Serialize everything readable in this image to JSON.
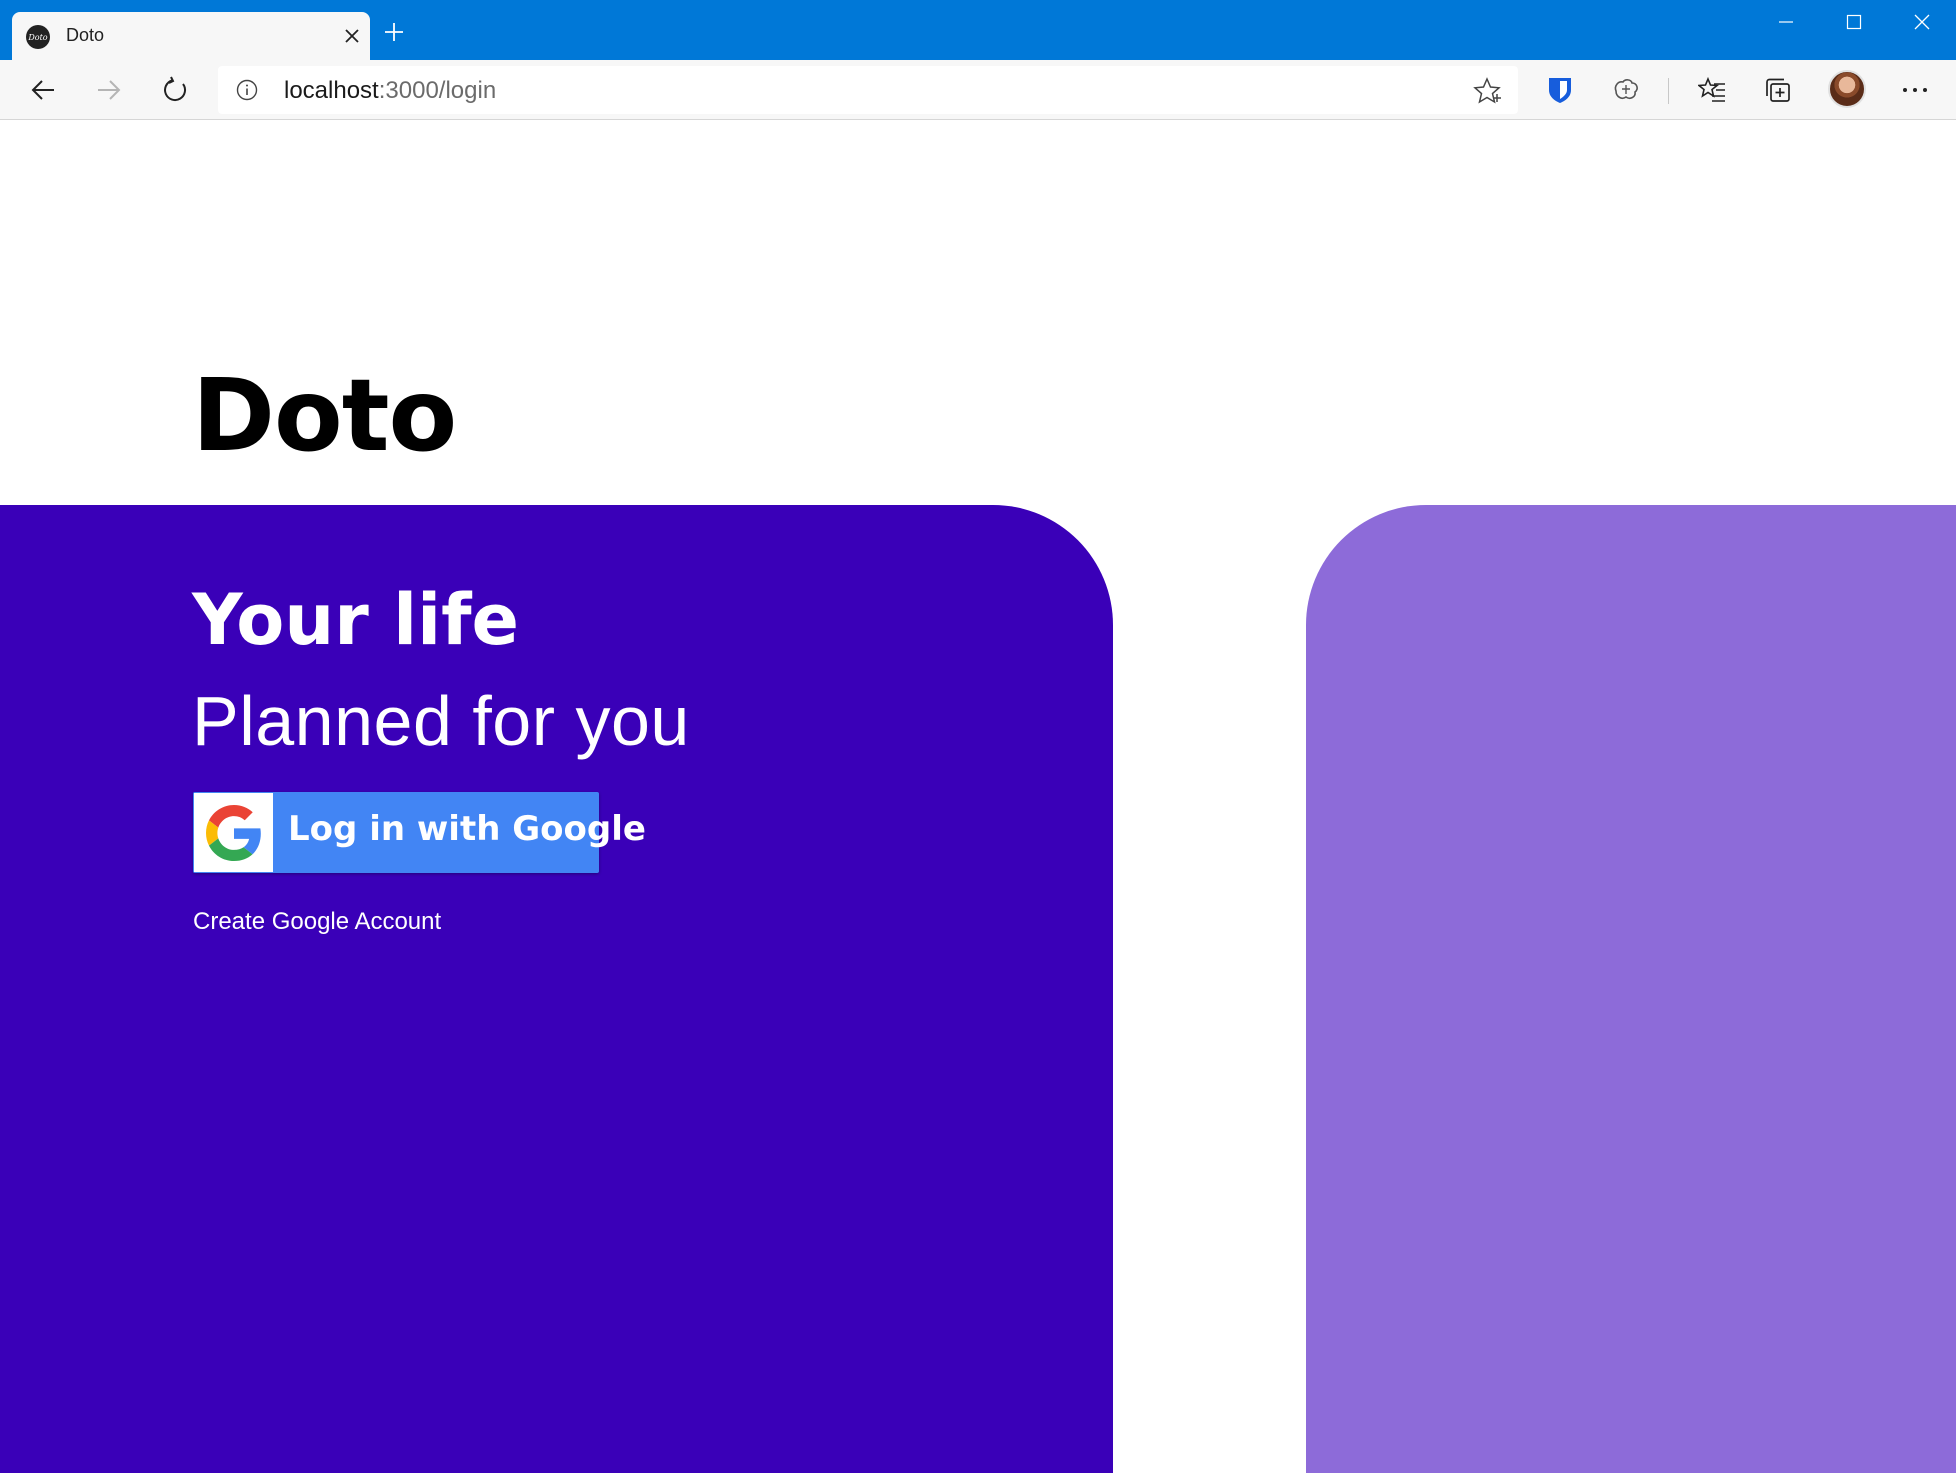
{
  "browser": {
    "tab": {
      "title": "Doto",
      "favicon_text": "Doto"
    },
    "new_tab_icon": "plus-icon",
    "window_controls": [
      "minimize-icon",
      "maximize-icon",
      "close-icon"
    ],
    "address": {
      "host": "localhost",
      "path": ":3000/login"
    },
    "toolbar_icons": [
      "back-arrow-icon",
      "forward-arrow-icon",
      "refresh-icon",
      "info-icon",
      "star-icon",
      "bitwarden-icon",
      "extension-icon",
      "favorites-icon",
      "collections-icon",
      "profile-avatar",
      "more-icon"
    ],
    "accent_color": "#0078d7"
  },
  "page": {
    "app_title": "Doto",
    "tagline_bold": "Your life",
    "tagline_light": "Planned for you",
    "login_button_label": "Log in with Google",
    "create_account_link": "Create Google Account",
    "colors": {
      "main_panel": "#3a00b8",
      "side_panel": "#8d6bd9",
      "google_button": "#4285f4"
    }
  }
}
